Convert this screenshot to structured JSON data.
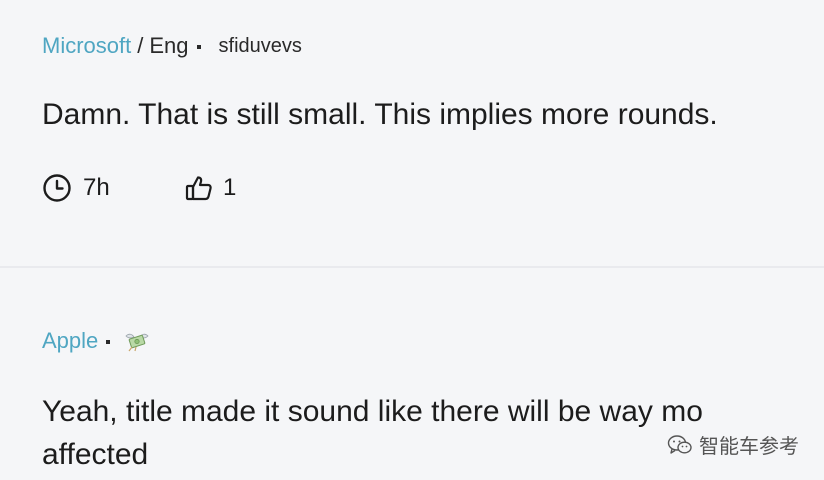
{
  "posts": [
    {
      "company": "Microsoft",
      "separator": "/",
      "subgroup": "Eng",
      "username": "sfiduvevs",
      "text": "Damn. That is still small. This implies more rounds.",
      "time": "7h",
      "likes": "1",
      "icons": {
        "time": "clock-icon",
        "likes": "thumbs-up-icon"
      }
    },
    {
      "company": "Apple",
      "user_icon": "money-with-wings-icon",
      "text": "Yeah, title made it sound like there will be way mo\naffected"
    }
  ],
  "watermark": {
    "text": "智能车参考",
    "icon": "wechat-icon"
  },
  "colors": {
    "company_link": "#4fa6c2",
    "background": "#f5f6f8",
    "divider": "#e9eaee",
    "text": "#1c1c1c"
  }
}
